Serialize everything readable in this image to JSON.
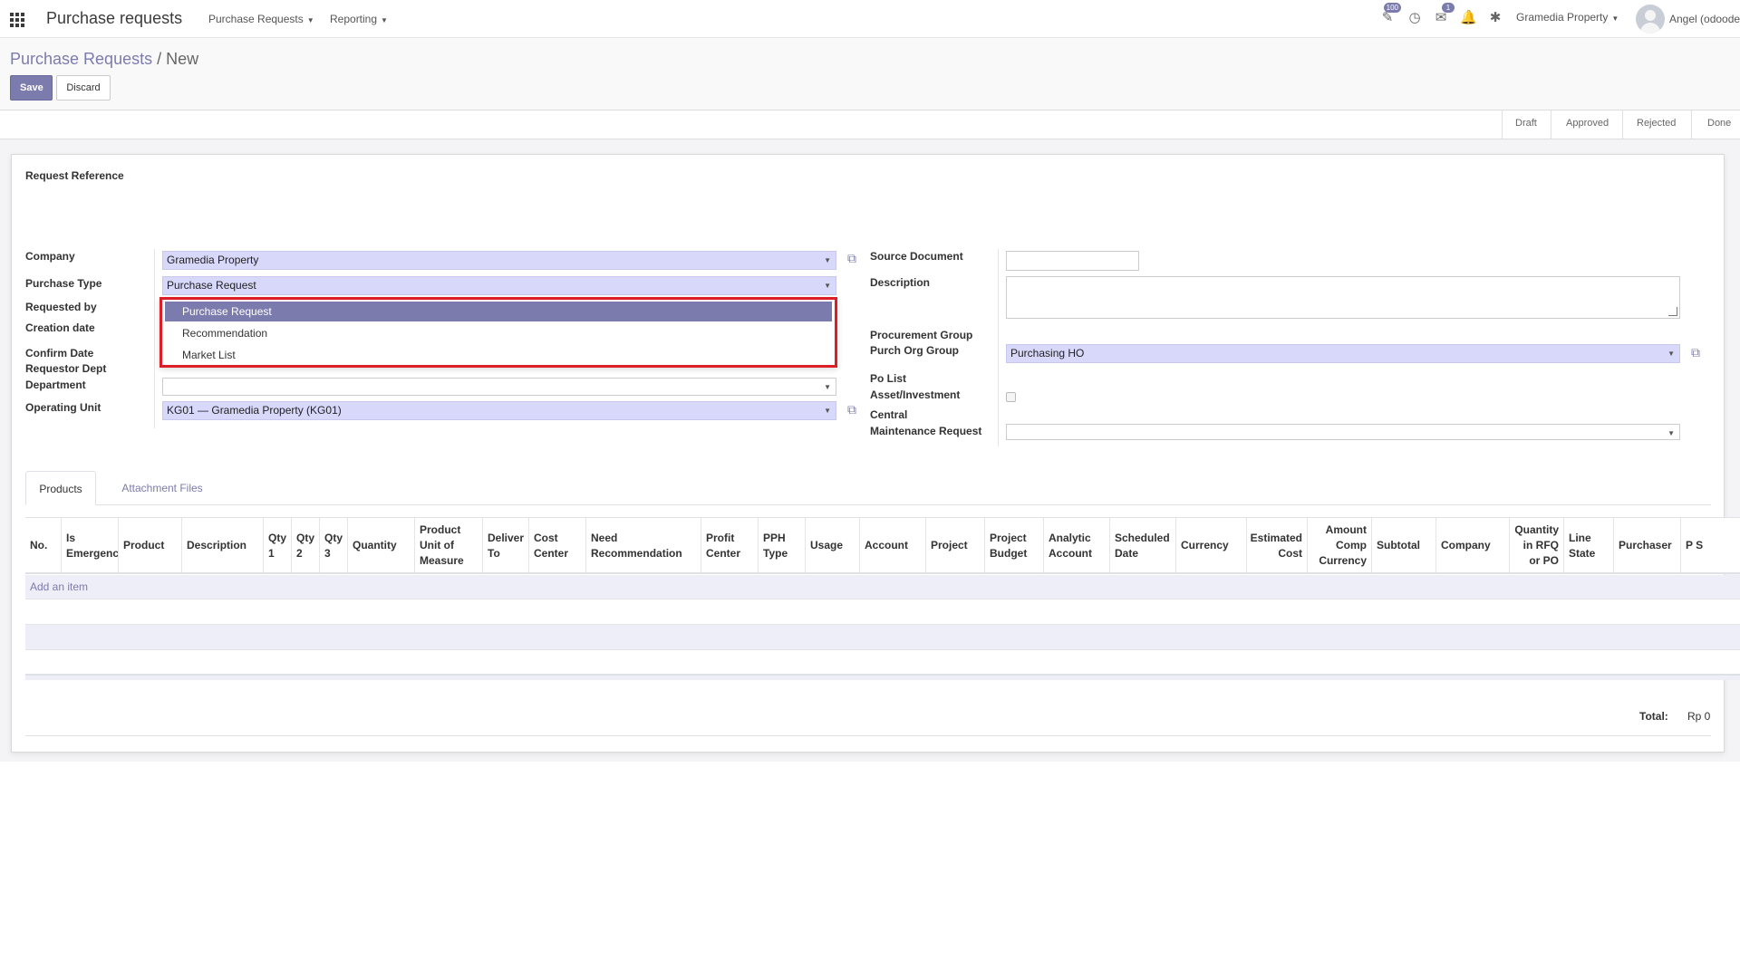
{
  "navbar": {
    "app_title": "Purchase requests",
    "menus": [
      {
        "label": "Purchase Requests"
      },
      {
        "label": "Reporting"
      }
    ],
    "activity_badge": "100",
    "messages_badge": "1",
    "company": "Gramedia Property",
    "user": "Angel (odoode"
  },
  "breadcrumb": {
    "parent": "Purchase Requests",
    "separator": "/",
    "current": "New"
  },
  "buttons": {
    "save": "Save",
    "discard": "Discard"
  },
  "statusbar": [
    "Draft",
    "Approved",
    "Rejected",
    "Done"
  ],
  "form": {
    "request_reference_label": "Request Reference",
    "left": {
      "company_label": "Company",
      "company_value": "Gramedia Property",
      "purchase_type_label": "Purchase Type",
      "purchase_type_value": "Purchase Request",
      "requested_by_label": "Requested by",
      "creation_date_label": "Creation date",
      "confirm_date_label": "Confirm Date",
      "requestor_dept_label": "Requestor Dept",
      "department_label": "Department",
      "operating_unit_label": "Operating Unit",
      "operating_unit_value": "KG01 — Gramedia Property (KG01)"
    },
    "right": {
      "source_document_label": "Source Document",
      "description_label": "Description",
      "procurement_group_label": "Procurement Group",
      "purch_org_group_label": "Purch Org Group",
      "purch_org_group_value": "Purchasing HO",
      "po_list_label": "Po List",
      "asset_investment_label": "Asset/Investment",
      "central_label": "Central",
      "maintenance_request_label": "Maintenance Request"
    },
    "dropdown_options": [
      "Purchase Request",
      "Recommendation",
      "Market List"
    ]
  },
  "tabs": [
    "Products",
    "Attachment Files"
  ],
  "table": {
    "columns": [
      "No.",
      "Is Emergency",
      "Product",
      "Description",
      "Qty 1",
      "Qty 2",
      "Qty 3",
      "Quantity",
      "Product Unit of Measure",
      "Deliver To",
      "Cost Center",
      "Need Recommendation",
      "Profit Center",
      "PPH Type",
      "Usage",
      "Account",
      "Project",
      "Project Budget",
      "Analytic Account",
      "Scheduled Date",
      "Currency",
      "Estimated Cost",
      "Amount Comp Currency",
      "Subtotal",
      "Company",
      "Quantity in RFQ or PO",
      "Line State",
      "Purchaser",
      "P S"
    ],
    "add_item": "Add an item",
    "total_label": "Total:",
    "total_value": "Rp 0"
  },
  "colors": {
    "accent": "#7c7bad",
    "field_bg": "#d8d8fb",
    "highlight_border": "#dd1e26"
  }
}
